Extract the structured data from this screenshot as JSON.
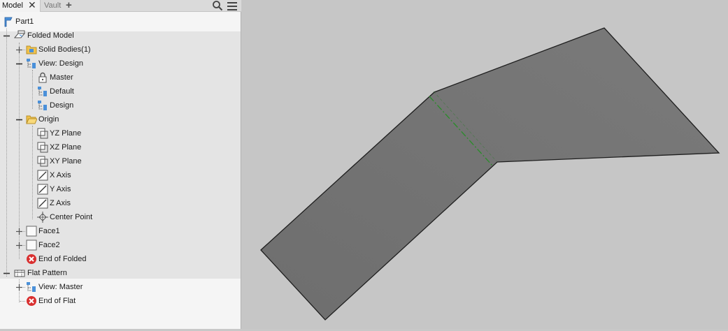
{
  "tabs": {
    "model": "Model",
    "vault": "Vault"
  },
  "tree": {
    "root": "Part1",
    "folded_model": "Folded Model",
    "solid_bodies": "Solid Bodies(1)",
    "view_design": "View: Design",
    "master": "Master",
    "default": "Default",
    "design": "Design",
    "origin": "Origin",
    "yz_plane": "YZ Plane",
    "xz_plane": "XZ Plane",
    "xy_plane": "XY Plane",
    "x_axis": "X Axis",
    "y_axis": "Y Axis",
    "z_axis": "Z Axis",
    "center_point": "Center Point",
    "face1": "Face1",
    "face2": "Face2",
    "end_of_folded": "End of Folded",
    "flat_pattern": "Flat Pattern",
    "view_master": "View: Master",
    "end_of_flat": "End of Flat"
  },
  "colors": {
    "part_face": "#727272",
    "bend_line": "#2e8b2e",
    "viewport_bg": "#c6c6c6",
    "error_red": "#d93030"
  }
}
